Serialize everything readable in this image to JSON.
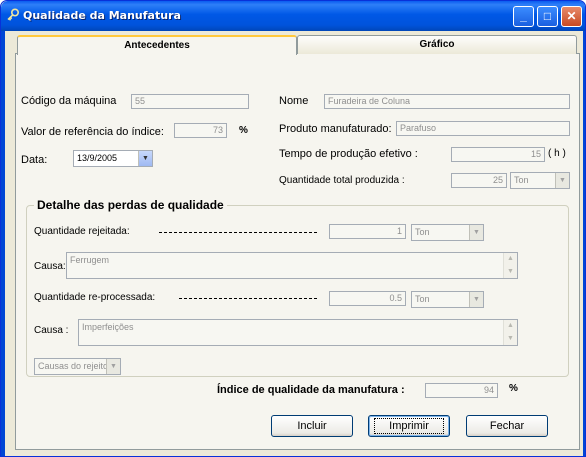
{
  "window": {
    "title": "Qualidade da Manufatura",
    "controls": {
      "minimize": "_",
      "maximize": "□",
      "close": "✕"
    }
  },
  "tabs": [
    {
      "label": "Antecedentes",
      "active": true
    },
    {
      "label": "Gráfico",
      "active": false
    }
  ],
  "fields": {
    "machine_code": {
      "label": "Código da máquina",
      "value": "55"
    },
    "name": {
      "label": "Nome",
      "value": "Furadeira de Coluna"
    },
    "reference_value": {
      "label": "Valor de referência do índice:",
      "value": "73",
      "unit": "%"
    },
    "product": {
      "label": "Produto manufaturado:",
      "value": "Parafuso"
    },
    "date": {
      "label": "Data:",
      "value": "13/9/2005"
    },
    "production_time": {
      "label": "Tempo de produção efetivo :",
      "value": "15",
      "unit": "( h )"
    },
    "total_quantity": {
      "label": "Quantidade total produzida :",
      "value": "25",
      "unit": "Ton"
    }
  },
  "loss_detail": {
    "title": "Detalhe das perdas de qualidade",
    "rejected": {
      "label": "Quantidade rejeitada:",
      "value": "1",
      "unit": "Ton"
    },
    "cause1": {
      "label": "Causa:",
      "value": "Ferrugem"
    },
    "reprocessed": {
      "label": "Quantidade re-processada:",
      "value": "0.5",
      "unit": "Ton"
    },
    "cause2": {
      "label": "Causa :",
      "value": "Imperfeições"
    },
    "causes_dropdown": "Causas do rejeito"
  },
  "quality_index": {
    "label": "Índice de qualidade da manufatura :",
    "value": "94",
    "unit": "%"
  },
  "buttons": {
    "include": "Incluir",
    "print": "Imprimir",
    "close": "Fechar"
  }
}
